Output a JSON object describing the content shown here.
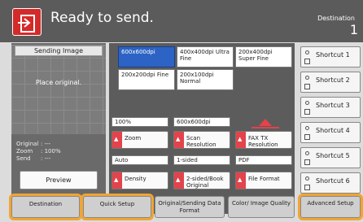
{
  "header": {
    "title": "Ready to send.",
    "destination_label": "Destination",
    "destination_count": "1"
  },
  "left": {
    "preview_header": "Sending Image",
    "place_original": "Place original.",
    "info": [
      {
        "label": "Original",
        "value": ":  ---"
      },
      {
        "label": "Zoom",
        "value": ":  100%"
      },
      {
        "label": "Send",
        "value": ":  ---"
      }
    ],
    "preview_button": "Preview"
  },
  "resolution": {
    "options": [
      {
        "label": "600x600dpi",
        "selected": true
      },
      {
        "label": "400x400dpi Ultra Fine",
        "selected": false
      },
      {
        "label": "200x400dpi Super Fine",
        "selected": false
      },
      {
        "label": "200x200dpi Fine",
        "selected": false
      },
      {
        "label": "200x100dpi Normal",
        "selected": false
      }
    ]
  },
  "functions": {
    "zoom": {
      "current": "100%",
      "label": "Zoom"
    },
    "scan_resolution": {
      "current": "600x600dpi",
      "label": "Scan Resolution"
    },
    "fax_tx": {
      "label": "FAX TX Resolution"
    },
    "density": {
      "current": "Auto",
      "label": "Density"
    },
    "sided": {
      "current": "1-sided",
      "label": "2-sided/Book Original"
    },
    "file_format": {
      "current": "PDF",
      "label": "File Format"
    }
  },
  "shortcuts": [
    "Shortcut 1",
    "Shortcut 2",
    "Shortcut 3",
    "Shortcut 4",
    "Shortcut 5",
    "Shortcut 6"
  ],
  "tabs": [
    {
      "label": "Destination",
      "highlight": true
    },
    {
      "label": "Quick Setup",
      "highlight": true
    },
    {
      "label": "Original/Sending Data Format",
      "highlight": false
    },
    {
      "label": "Color/ Image Quality",
      "highlight": false
    },
    {
      "label": "Advanced Setup",
      "highlight": true
    }
  ],
  "colors": {
    "accent_red": "#e3434b",
    "selected_blue": "#2d63c4",
    "highlight_orange": "#f0a534"
  }
}
